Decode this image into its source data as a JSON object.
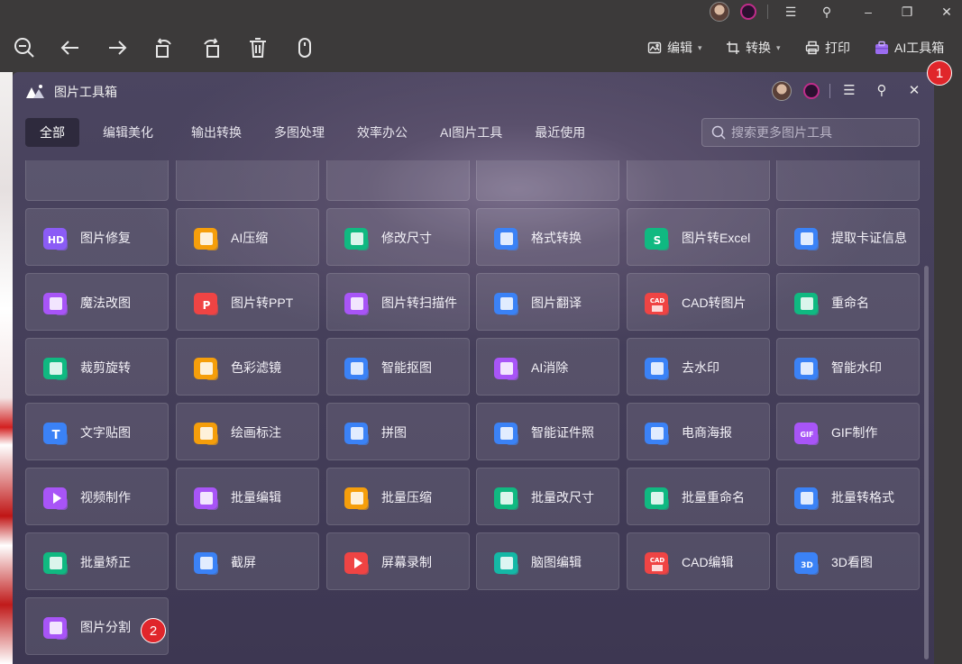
{
  "titlebar": {},
  "toolbar": {
    "menus": [
      {
        "label": "编辑",
        "icon": "image-edit-icon"
      },
      {
        "label": "转换",
        "icon": "crop-icon"
      },
      {
        "label": "打印",
        "icon": "printer-icon"
      },
      {
        "label": "AI工具箱",
        "icon": "toolbox-icon"
      }
    ]
  },
  "panel": {
    "title": "图片工具箱",
    "tabs": [
      "全部",
      "编辑美化",
      "输出转换",
      "多图处理",
      "效率办公",
      "AI图片工具",
      "最近使用"
    ],
    "active_tab": 0,
    "search_placeholder": "搜索更多图片工具"
  },
  "tools": [
    [
      {
        "label": "图片修复",
        "icon": "hd-repair-icon",
        "color": "#8b5cf6"
      },
      {
        "label": "AI压缩",
        "icon": "ai-compress-icon",
        "color": "#f59e0b"
      },
      {
        "label": "修改尺寸",
        "icon": "resize-icon",
        "color": "#10b981"
      },
      {
        "label": "格式转换",
        "icon": "format-convert-icon",
        "color": "#3b82f6"
      },
      {
        "label": "图片转Excel",
        "icon": "excel-icon",
        "color": "#10b981"
      },
      {
        "label": "提取卡证信息",
        "icon": "id-card-icon",
        "color": "#3b82f6"
      }
    ],
    [
      {
        "label": "魔法改图",
        "icon": "magic-wand-icon",
        "color": "#a855f7"
      },
      {
        "label": "图片转PPT",
        "icon": "ppt-icon",
        "color": "#ef4444"
      },
      {
        "label": "图片转扫描件",
        "icon": "scan-icon",
        "color": "#a855f7"
      },
      {
        "label": "图片翻译",
        "icon": "translate-icon",
        "color": "#3b82f6"
      },
      {
        "label": "CAD转图片",
        "icon": "cad-icon",
        "color": "#ef4444"
      },
      {
        "label": "重命名",
        "icon": "rename-icon",
        "color": "#10b981"
      }
    ],
    [
      {
        "label": "裁剪旋转",
        "icon": "crop-rotate-icon",
        "color": "#10b981"
      },
      {
        "label": "色彩滤镜",
        "icon": "color-filter-icon",
        "color": "#f59e0b"
      },
      {
        "label": "智能抠图",
        "icon": "cutout-icon",
        "color": "#3b82f6"
      },
      {
        "label": "AI消除",
        "icon": "eraser-icon",
        "color": "#a855f7"
      },
      {
        "label": "去水印",
        "icon": "remove-watermark-icon",
        "color": "#3b82f6"
      },
      {
        "label": "智能水印",
        "icon": "add-watermark-icon",
        "color": "#3b82f6"
      }
    ],
    [
      {
        "label": "文字贴图",
        "icon": "text-sticker-icon",
        "color": "#3b82f6"
      },
      {
        "label": "绘画标注",
        "icon": "paint-annotate-icon",
        "color": "#f59e0b"
      },
      {
        "label": "拼图",
        "icon": "collage-icon",
        "color": "#3b82f6"
      },
      {
        "label": "智能证件照",
        "icon": "id-photo-icon",
        "color": "#3b82f6"
      },
      {
        "label": "电商海报",
        "icon": "poster-icon",
        "color": "#3b82f6"
      },
      {
        "label": "GIF制作",
        "icon": "gif-icon",
        "color": "#a855f7"
      }
    ],
    [
      {
        "label": "视频制作",
        "icon": "video-icon",
        "color": "#a855f7"
      },
      {
        "label": "批量编辑",
        "icon": "batch-edit-icon",
        "color": "#a855f7"
      },
      {
        "label": "批量压缩",
        "icon": "batch-compress-icon",
        "color": "#f59e0b"
      },
      {
        "label": "批量改尺寸",
        "icon": "batch-resize-icon",
        "color": "#10b981"
      },
      {
        "label": "批量重命名",
        "icon": "batch-rename-icon",
        "color": "#10b981"
      },
      {
        "label": "批量转格式",
        "icon": "batch-convert-icon",
        "color": "#3b82f6"
      }
    ],
    [
      {
        "label": "批量矫正",
        "icon": "batch-correct-icon",
        "color": "#10b981"
      },
      {
        "label": "截屏",
        "icon": "screenshot-icon",
        "color": "#3b82f6"
      },
      {
        "label": "屏幕录制",
        "icon": "screen-record-icon",
        "color": "#ef4444"
      },
      {
        "label": "脑图编辑",
        "icon": "mindmap-icon",
        "color": "#14b8a6"
      },
      {
        "label": "CAD编辑",
        "icon": "cad-edit-icon",
        "color": "#ef4444"
      },
      {
        "label": "3D看图",
        "icon": "3d-view-icon",
        "color": "#3b82f6"
      }
    ],
    [
      {
        "label": "图片分割",
        "icon": "split-icon",
        "color": "#a855f7"
      }
    ]
  ],
  "markers": [
    "1",
    "2"
  ]
}
